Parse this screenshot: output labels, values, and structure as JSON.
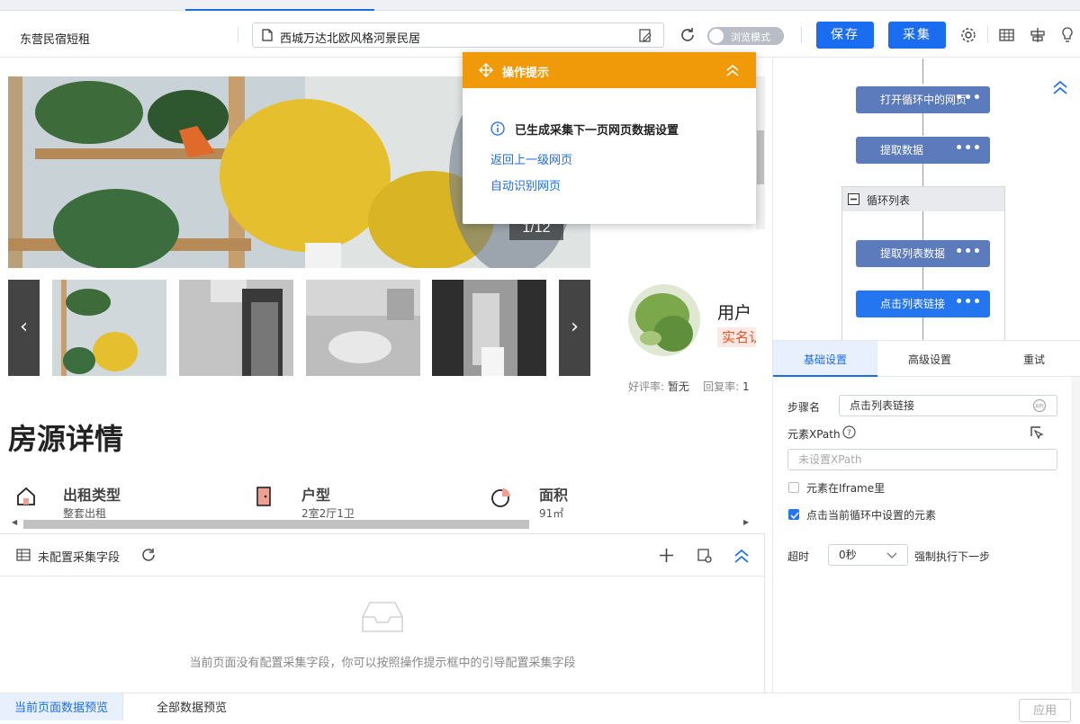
{
  "toolbar": {
    "tab_title": "东营民宿短租",
    "url": "西城万达北欧风格河景民居",
    "browse_mode": "浏览模式",
    "save": "保存",
    "collect": "采集"
  },
  "page": {
    "photo_counter": "1/12",
    "section_title": "房源详情",
    "features": [
      {
        "label": "出租类型",
        "value": "整套出租"
      },
      {
        "label": "户型",
        "value": "2室2厅1卫"
      },
      {
        "label": "面积",
        "value": "91㎡"
      }
    ],
    "user": {
      "name": "用户",
      "verified": "实名认证",
      "rating_label": "好评率:",
      "rating_value": "暂无",
      "reply_label": "回复率:",
      "reply_value": "1"
    }
  },
  "tip_popup": {
    "title": "操作提示",
    "message": "已生成采集下一页网页数据设置",
    "links": [
      "返回上一级网页",
      "自动识别网页"
    ]
  },
  "fields_panel": {
    "title": "未配置采集字段",
    "empty_text": "当前页面没有配置采集字段，你可以按照操作提示框中的引导配置采集字段"
  },
  "bottom_tabs": [
    "当前页面数据预览",
    "全部数据预览"
  ],
  "apply": "应用",
  "workflow": {
    "steps": [
      "打开循环中的网页",
      "提取数据",
      "提取列表数据",
      "点击列表链接"
    ],
    "loop_label": "循环列表",
    "dots": "•••"
  },
  "settings": {
    "tabs": [
      "基础设置",
      "高级设置",
      "重试"
    ],
    "step_name_label": "步骤名",
    "step_name_value": "点击列表链接",
    "xpath_label": "元素XPath",
    "xpath_placeholder": "未设置XPath",
    "iframe_label": "元素在Iframe里",
    "loop_elem_label": "点击当前循环中设置的元素",
    "timeout_label": "超时",
    "timeout_value": "0秒",
    "force_label": "强制执行下一步"
  }
}
